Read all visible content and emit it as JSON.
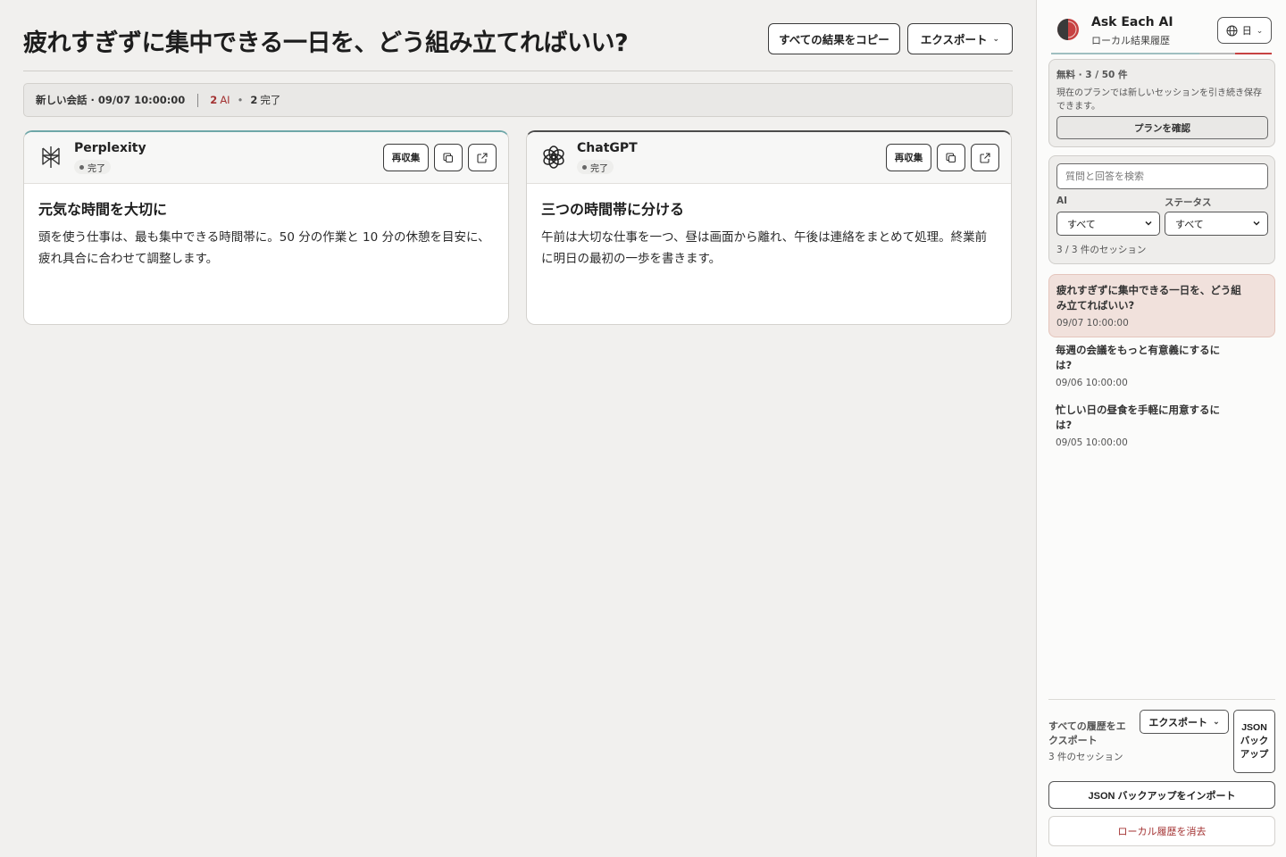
{
  "header": {
    "title": "疲れすぎずに集中できる一日を、どう組み立てればいい?",
    "copy_all_label": "すべての結果をコピー",
    "export_label": "エクスポート"
  },
  "status": {
    "conversation": "新しい会話 · 09/07 10:00:00",
    "ai_count": "2",
    "ai_label": "AI",
    "done_count": "2",
    "done_label": "完了"
  },
  "cards": [
    {
      "name": "Perplexity",
      "state": "完了",
      "recollect_label": "再収集",
      "heading": "元気な時間を大切に",
      "text": "頭を使う仕事は、最も集中できる時間帯に。50 分の作業と 10 分の休憩を目安に、疲れ具合に合わせて調整します。",
      "icon": "perplexity-logo",
      "accent": "#6ea7a8"
    },
    {
      "name": "ChatGPT",
      "state": "完了",
      "recollect_label": "再収集",
      "heading": "三つの時間帯に分ける",
      "text": "午前は大切な仕事を一つ、昼は画面から離れ、午後は連絡をまとめて処理。終業前に明日の最初の一歩を書きます。",
      "icon": "chatgpt-logo",
      "accent": "#4c4c4c"
    }
  ],
  "sidebar": {
    "title": "Ask Each AI",
    "subtitle": "ローカル結果履歴",
    "lang": "日",
    "plan": {
      "title": "無料 · 3 / 50 件",
      "desc": "現在のプランでは新しいセッションを引き続き保存できます。",
      "button": "プランを確認"
    },
    "search_placeholder": "質問と回答を検索",
    "filter_ai_label": "AI",
    "filter_status_label": "ステータス",
    "filter_ai_value": "すべて",
    "filter_status_value": "すべて",
    "session_count": "3 / 3 件のセッション",
    "sessions": [
      {
        "q": "疲れすぎずに集中できる一日を、どう組み立てればいい?",
        "d": "09/07 10:00:00"
      },
      {
        "q": "毎週の会議をもっと有意義にするには?",
        "d": "09/06 10:00:00"
      },
      {
        "q": "忙しい日の昼食を手軽に用意するには?",
        "d": "09/05 10:00:00"
      }
    ],
    "export_all_label": "すべての履歴をエクスポート",
    "export_count": "3 件のセッション",
    "export_button": "エクスポート",
    "json_backup_button": "JSON バックアップ",
    "import_button": "JSON バックアップをインポート",
    "clear_button": "ローカル履歴を消去"
  },
  "colors": {
    "accent_red": "#a33232",
    "active_session_bg": "#f1e1dc",
    "page_bg": "#f1f0ee"
  }
}
